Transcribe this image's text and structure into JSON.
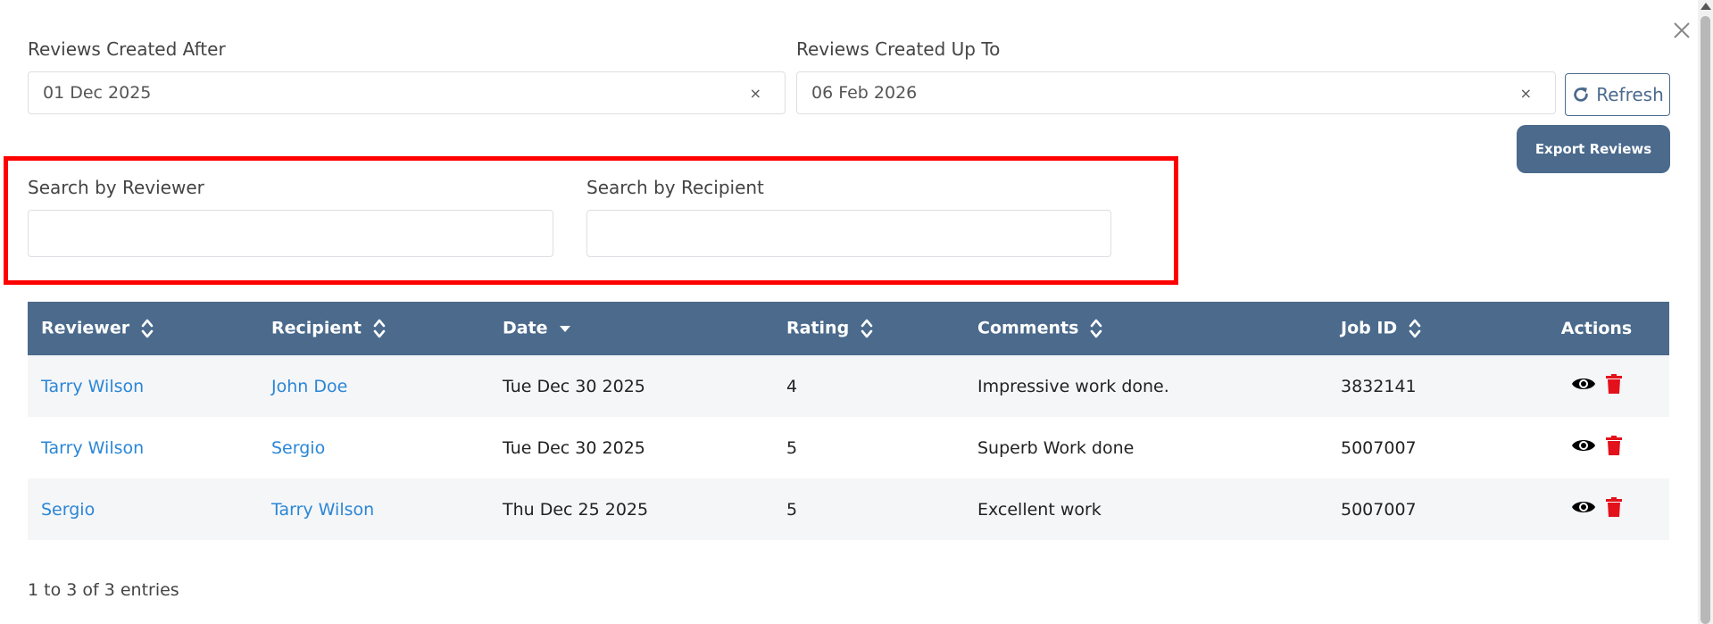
{
  "filters": {
    "created_after_label": "Reviews Created After",
    "created_after_value": "01 Dec 2025",
    "created_up_to_label": "Reviews Created Up To",
    "created_up_to_value": "06 Feb 2026",
    "clear_symbol": "×",
    "refresh_label": "Refresh",
    "export_label": "Export Reviews"
  },
  "search": {
    "reviewer_label": "Search by Reviewer",
    "reviewer_value": "",
    "recipient_label": "Search by Recipient",
    "recipient_value": ""
  },
  "table": {
    "headers": [
      "Reviewer",
      "Recipient",
      "Date",
      "Rating",
      "Comments",
      "Job ID",
      "Actions"
    ],
    "rows": [
      {
        "reviewer": "Tarry Wilson",
        "recipient": "John Doe",
        "date": "Tue Dec 30 2025",
        "rating": "4",
        "comments": "Impressive work done.",
        "job_id": "3832141"
      },
      {
        "reviewer": "Tarry Wilson",
        "recipient": "Sergio",
        "date": "Tue Dec 30 2025",
        "rating": "5",
        "comments": "Superb Work done",
        "job_id": "5007007"
      },
      {
        "reviewer": "Sergio",
        "recipient": "Tarry Wilson",
        "date": "Thu Dec 25 2025",
        "rating": "5",
        "comments": "Excellent work",
        "job_id": "5007007"
      }
    ]
  },
  "footer": {
    "entries_text": "1 to 3 of 3 entries"
  },
  "icons": {
    "close": "close-icon",
    "refresh": "refresh-icon",
    "sort": "sort-icon",
    "sort_down": "sort-down-icon",
    "view": "eye-icon",
    "delete": "trash-icon"
  },
  "colors": {
    "header_bg": "#4b6a8c",
    "link": "#2a86d6",
    "highlight": "#ff0000",
    "delete": "#e3111b"
  }
}
